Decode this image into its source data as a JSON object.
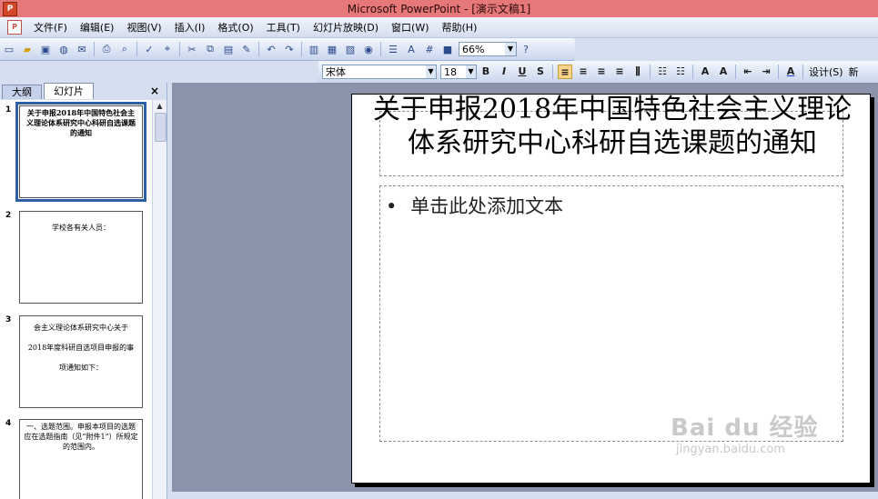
{
  "window": {
    "title": "Microsoft PowerPoint - [演示文稿1]"
  },
  "menu": [
    "文件(F)",
    "编辑(E)",
    "视图(V)",
    "插入(I)",
    "格式(O)",
    "工具(T)",
    "幻灯片放映(D)",
    "窗口(W)",
    "帮助(H)"
  ],
  "toolbar": {
    "zoom": "66%"
  },
  "format": {
    "font": "宋体",
    "size": "18",
    "bold": "B",
    "italic": "I",
    "underline": "U",
    "shadow": "S",
    "design_label": "设计(S)",
    "new_label": "新"
  },
  "pane": {
    "tab_outline": "大纲",
    "tab_slides": "幻灯片",
    "close": "×",
    "thumbs": [
      {
        "num": "1",
        "lines": [
          "关于申报2018年中国特色社会主义理论体系研究中心科研自选课题的通知"
        ]
      },
      {
        "num": "2",
        "lines": [
          "学校各有关人员："
        ]
      },
      {
        "num": "3",
        "lines": [
          "会主义理论体系研究中心关于",
          "2018年度科研自选项目申报的事",
          "项通知如下："
        ]
      },
      {
        "num": "4",
        "lines": [
          "一、选题范围。申报本项目的选题应在选题指南（见“附件1”）所规定的范围内。"
        ]
      }
    ]
  },
  "slide": {
    "title": "关于申报2018年中国特色社会主义理论体系研究中心科研自选课题的通知",
    "body_bullet": "•",
    "body": "单击此处添加文本"
  },
  "watermark": {
    "line1": "Bai du 经验",
    "line2": "jingyan.baidu.com"
  }
}
